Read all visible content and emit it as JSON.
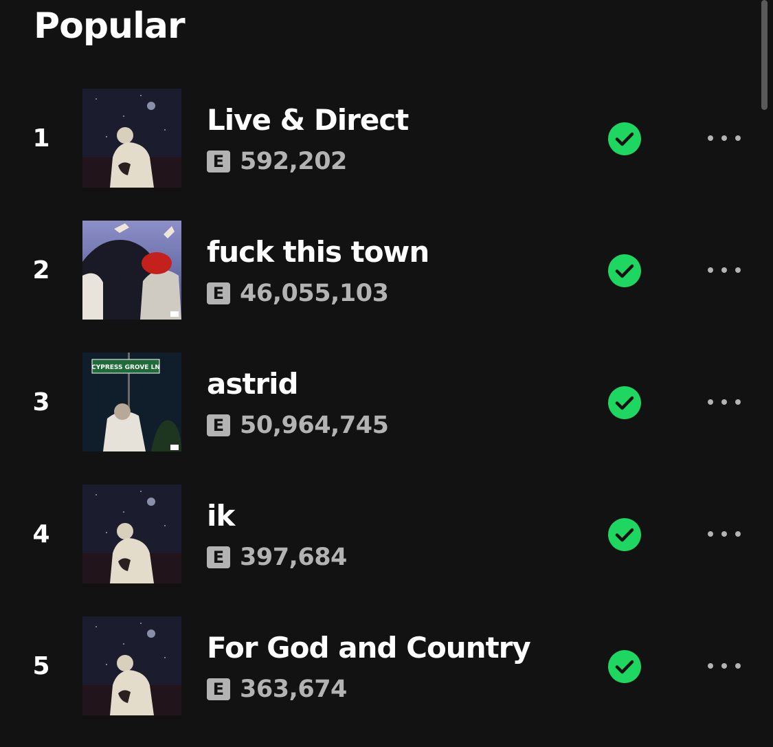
{
  "section": {
    "title": "Popular"
  },
  "colors": {
    "background": "#121212",
    "accent_green": "#1ed760",
    "secondary_text": "#b3b3b3",
    "badge_bg": "#b3b3b3"
  },
  "tracks": [
    {
      "rank": "1",
      "title": "Live & Direct",
      "explicit": "E",
      "plays": "592,202",
      "saved_icon": "check-circle-icon",
      "more_icon": "more-options-icon",
      "cover": "night-sky-embrace"
    },
    {
      "rank": "2",
      "title": "fuck this town",
      "explicit": "E",
      "plays": "46,055,103",
      "saved_icon": "check-circle-icon",
      "more_icon": "more-options-icon",
      "cover": "two-figures-red-cap"
    },
    {
      "rank": "3",
      "title": "astrid",
      "explicit": "E",
      "plays": "50,964,745",
      "saved_icon": "check-circle-icon",
      "more_icon": "more-options-icon",
      "cover": "street-sign-night",
      "cover_text": "CYPRESS GROVE LN"
    },
    {
      "rank": "4",
      "title": "ik",
      "explicit": "E",
      "plays": "397,684",
      "saved_icon": "check-circle-icon",
      "more_icon": "more-options-icon",
      "cover": "night-sky-embrace"
    },
    {
      "rank": "5",
      "title": "For God and Country",
      "explicit": "E",
      "plays": "363,674",
      "saved_icon": "check-circle-icon",
      "more_icon": "more-options-icon",
      "cover": "night-sky-embrace"
    }
  ]
}
